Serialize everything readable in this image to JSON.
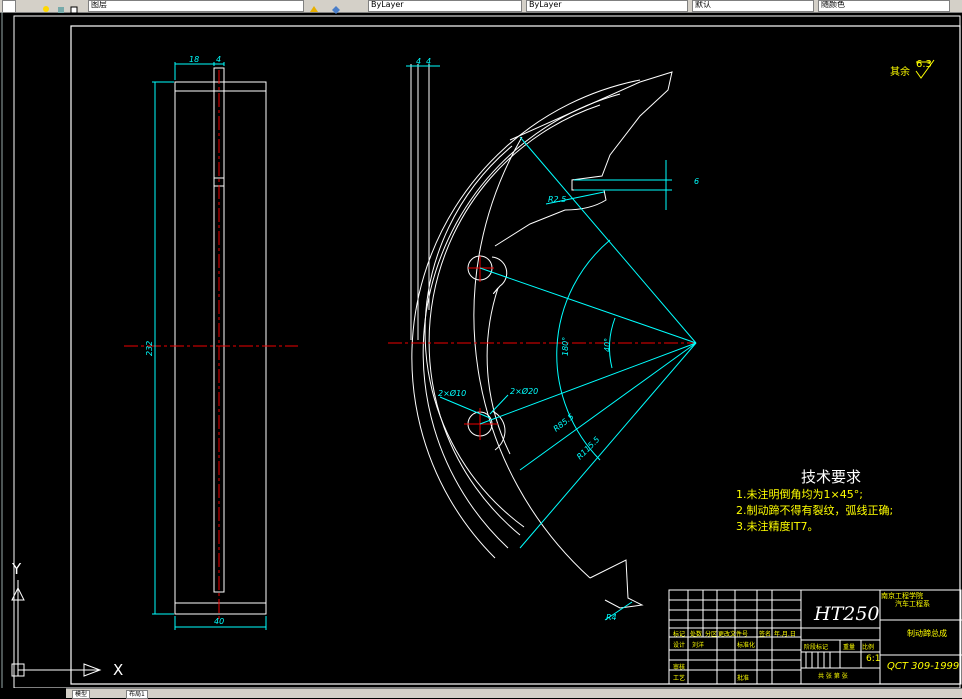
{
  "toolbar": {
    "layer_field": "图层",
    "linetype1": "ByLayer",
    "linetype2": "ByLayer",
    "lineweight": "默认",
    "plotstyle": "随颜色"
  },
  "drawing": {
    "dims": {
      "width_top": "18",
      "width_small": "4",
      "height": "232",
      "width_bottom": "40",
      "r_slot": "R2.5",
      "slot_w": "6",
      "angle_180": "180°",
      "angle_40": "40°",
      "hole_small": "2×Ø10",
      "hole_large": "2×Ø20",
      "r_inner": "R85.5",
      "r_outer": "R115.5",
      "r4": "R4",
      "small_top1": "4",
      "small_top2": "4"
    },
    "surface_note": "其余",
    "surface_value": "6.3"
  },
  "tech": {
    "title": "技术要求",
    "lines": [
      "1.未注明倒角均为1×45°;",
      "2.制动蹄不得有裂纹，弧线正确;",
      "3.未注精度IT7。"
    ]
  },
  "titleblock": {
    "material": "HT250",
    "school": "南京工程学院",
    "dept": "汽车工程系",
    "part_name": "制动蹄总成",
    "standard": "QCT 309-1999",
    "scale": "6:1",
    "labels": {
      "mark": "标记",
      "count": "处数",
      "zone": "分区",
      "change": "更改文件号",
      "sign": "签名",
      "date": "年.月.日",
      "design": "设计",
      "standardize": "标准化",
      "check": "审核",
      "process": "工艺",
      "approve": "批准",
      "stage": "阶段标记",
      "weight": "重量",
      "ratio": "比例",
      "sheets": "共 张 第 张",
      "designer_name": "刘洋"
    }
  },
  "ucs": {
    "x": "X",
    "y": "Y"
  },
  "statusbar": {
    "tab1": "模型",
    "tab2": "布局1"
  }
}
